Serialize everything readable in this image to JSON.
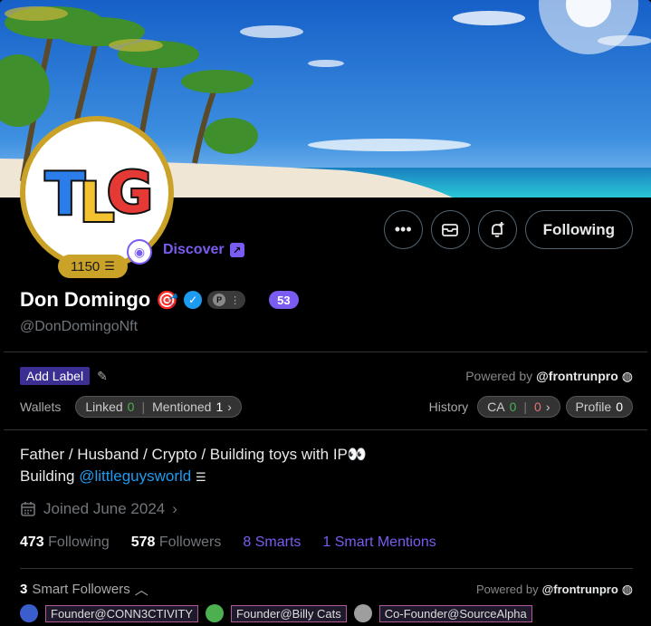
{
  "profile": {
    "display_name": "Don Domingo",
    "handle": "@DonDomingoNft",
    "rank": "1150",
    "score": "53",
    "discover_label": "Discover"
  },
  "header": {
    "following_label": "Following"
  },
  "labels": {
    "add_label": "Add Label",
    "powered_by": "Powered by",
    "powered_by_handle": "@frontrunpro"
  },
  "wallets": {
    "label": "Wallets",
    "linked_label": "Linked",
    "linked_count": "0",
    "mentioned_label": "Mentioned",
    "mentioned_count": "1",
    "history_label": "History",
    "ca_label": "CA",
    "ca_green": "0",
    "ca_red": "0",
    "profile_label": "Profile",
    "profile_count": "0"
  },
  "bio": {
    "line1": "Father / Husband / Crypto / Building toys with IP",
    "line1_emoji": "👀",
    "line2_prefix": "Building ",
    "line2_link": "@littleguysworld"
  },
  "joined": "Joined June 2024",
  "stats": {
    "following_count": "473",
    "following_label": "Following",
    "followers_count": "578",
    "followers_label": "Followers",
    "smarts": "8 Smarts",
    "smart_mentions": "1 Smart Mentions"
  },
  "smart_followers": {
    "count": "3",
    "label": "Smart Followers",
    "powered_by": "Powered by",
    "powered_by_handle": "@frontrunpro",
    "tags": [
      {
        "label": "Founder@CONN3CTIVITY",
        "avatar_color": "#3a5fcd"
      },
      {
        "label": "Founder@Billy Cats",
        "avatar_color": "#4caf50"
      },
      {
        "label": "Co-Founder@SourceAlpha",
        "avatar_color": "#9e9e9e"
      }
    ]
  },
  "icons": {
    "more": "more-icon",
    "message": "message-icon",
    "notify": "notify-icon",
    "verified": "verified-icon",
    "calendar": "calendar-icon"
  }
}
